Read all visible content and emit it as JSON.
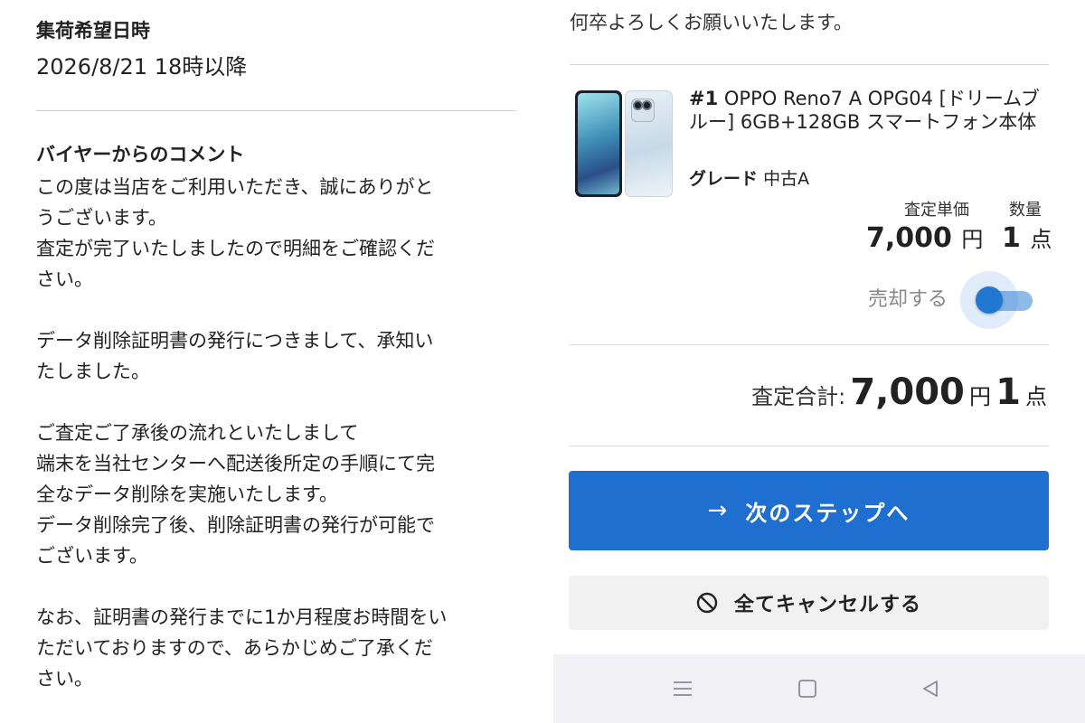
{
  "left": {
    "pickup_label": "集荷希望日時",
    "pickup_value": "2026/8/21 18時以降",
    "comment_label": "バイヤーからのコメント",
    "comment_lines": [
      "この度は当店をご利用いただき、誠にありがと",
      "うございます。",
      "査定が完了いたしましたので明細をご確認くだ",
      "さい。",
      "",
      "データ削除証明書の発行につきまして、承知い",
      "たしました。",
      "",
      "ご査定ご了承後の流れといたしまして",
      "端末を当社センターへ配送後所定の手順にて完",
      "全なデータ削除を実施いたします。",
      "データ削除完了後、削除証明書の発行が可能で",
      "ございます。",
      "",
      "なお、証明書の発行までに1か月程度お時間をい",
      "ただいておりますので、あらかじめご了承くだ",
      "さい。"
    ]
  },
  "right": {
    "greeting": "何卒よろしくお願いいたします。",
    "product": {
      "number": "#1",
      "name": " OPPO Reno7 A OPG04 [ドリームブルー] 6GB+128GB スマートフォン本体",
      "grade_label": "グレード",
      "grade_value": "中古A",
      "unit_price_label": "査定単価",
      "quantity_label": "数量",
      "unit_price": "7,000",
      "unit_price_currency": "円",
      "quantity": "1",
      "quantity_unit": "点",
      "sell_label": "売却する",
      "sell_enabled": true,
      "image_icon": "smartphone-image"
    },
    "total": {
      "label": "査定合計:",
      "amount": "7,000",
      "currency": "円",
      "quantity": "1",
      "quantity_unit": "点"
    },
    "next_button": {
      "label": "次のステップへ",
      "icon": "arrow-right-icon"
    },
    "cancel_button": {
      "label": "全てキャンセルする",
      "icon": "prohibit-icon"
    },
    "navbar": {
      "icons": [
        "menu-icon",
        "home-square-icon",
        "back-triangle-icon"
      ]
    },
    "colors": {
      "primary": "#1f6fd1",
      "toggle_knob": "#2277d0",
      "toggle_track": "#8fbbe8",
      "cancel_bg": "#f1f1f1"
    }
  }
}
